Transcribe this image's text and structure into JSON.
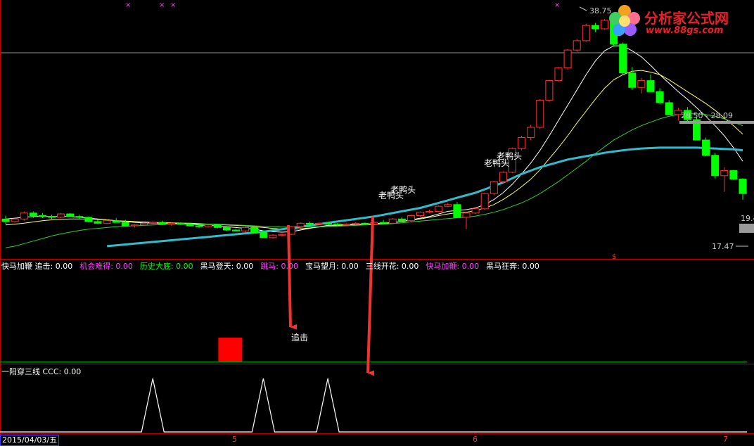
{
  "colors": {
    "up": "#ff3232",
    "down": "#00ff00",
    "ma_white": "#ffffff",
    "ma_yellow": "#ffff66",
    "ma_green": "#33cc33",
    "ma_cyan": "#33bbcc",
    "magenta": "#ff44ff",
    "signal_red": "#ff0000",
    "arrow": "#ee3333"
  },
  "logo": {
    "title": "分析家公式网",
    "url": "www.88gs.com"
  },
  "price_labels": {
    "high": "38.75",
    "range": "28.50 - 28.09",
    "low": "17.47",
    "right_cut": "19.4"
  },
  "annotations": {
    "pattern_a": "老鸭头",
    "pattern_b": "老鸭头",
    "signal_label": "追击"
  },
  "indicator_panel": {
    "items": [
      {
        "label": "快马加鞭 追击: 0.00",
        "color": "#ffffff"
      },
      {
        "label": "机会难得: 0.00",
        "color": "#ff44ff"
      },
      {
        "label": "历史大底: 0.00",
        "color": "#00ff00"
      },
      {
        "label": "黑马登天: 0.00",
        "color": "#ffffff"
      },
      {
        "label": "跳马: 0.00",
        "color": "#ff44ff"
      },
      {
        "label": "宝马望月: 0.00",
        "color": "#ffffff"
      },
      {
        "label": "三线开花: 0.00",
        "color": "#ffffff"
      },
      {
        "label": "快马加鞭: 0.00",
        "color": "#ff44ff"
      },
      {
        "label": "黑马狂奔: 0.00",
        "color": "#ffffff"
      }
    ]
  },
  "lower_panel": {
    "label": "一阳穿三线 CCC: 0.00"
  },
  "x_axis": {
    "date": "2015/04/03/五",
    "ticks": [
      "5",
      "6",
      "7"
    ]
  },
  "chart_data": {
    "type": "candlestick",
    "candles": [
      [
        15.2,
        15.6,
        14.6,
        14.9
      ],
      [
        14.9,
        15.3,
        14.8,
        15.2
      ],
      [
        15.2,
        16.1,
        15.0,
        15.9
      ],
      [
        15.9,
        16.1,
        15.3,
        15.6
      ],
      [
        15.6,
        15.9,
        15.3,
        15.5
      ],
      [
        15.5,
        15.7,
        15.2,
        15.4
      ],
      [
        15.4,
        15.9,
        15.3,
        15.8
      ],
      [
        15.8,
        15.9,
        15.4,
        15.5
      ],
      [
        15.5,
        15.7,
        15.2,
        15.4
      ],
      [
        15.4,
        15.5,
        14.8,
        14.9
      ],
      [
        14.9,
        15.1,
        14.6,
        14.7
      ],
      [
        14.7,
        15.1,
        14.6,
        15.0
      ],
      [
        15.0,
        15.3,
        14.8,
        14.8
      ],
      [
        14.8,
        15.1,
        14.3,
        14.4
      ],
      [
        14.4,
        14.6,
        14.2,
        14.5
      ],
      [
        14.5,
        14.8,
        14.4,
        14.7
      ],
      [
        14.7,
        14.9,
        14.6,
        14.8
      ],
      [
        14.8,
        15.0,
        14.5,
        14.6
      ],
      [
        14.6,
        14.8,
        14.4,
        14.7
      ],
      [
        14.7,
        14.8,
        14.5,
        14.6
      ],
      [
        14.6,
        14.7,
        14.3,
        14.4
      ],
      [
        14.4,
        14.6,
        14.2,
        14.3
      ],
      [
        14.3,
        14.6,
        14.2,
        14.5
      ],
      [
        14.5,
        14.6,
        14.1,
        14.2
      ],
      [
        14.2,
        14.4,
        13.8,
        13.9
      ],
      [
        13.9,
        14.1,
        13.7,
        13.8
      ],
      [
        13.8,
        14.3,
        13.6,
        14.2
      ],
      [
        14.2,
        14.4,
        13.8,
        13.6
      ],
      [
        13.6,
        13.8,
        13.0,
        13.0
      ],
      [
        13.0,
        13.4,
        12.9,
        13.3
      ],
      [
        13.3,
        13.5,
        13.1,
        13.4
      ],
      [
        13.4,
        14.4,
        13.3,
        14.3
      ],
      [
        14.3,
        14.8,
        14.1,
        14.7
      ],
      [
        14.7,
        14.9,
        14.5,
        14.6
      ],
      [
        14.6,
        14.8,
        14.5,
        14.7
      ],
      [
        14.7,
        14.8,
        14.5,
        14.6
      ],
      [
        14.6,
        14.7,
        14.4,
        14.5
      ],
      [
        14.5,
        14.7,
        14.4,
        14.6
      ],
      [
        14.6,
        14.8,
        14.5,
        14.7
      ],
      [
        14.7,
        14.8,
        14.5,
        14.6
      ],
      [
        14.6,
        14.9,
        14.5,
        14.8
      ],
      [
        14.8,
        15.1,
        14.6,
        14.7
      ],
      [
        14.7,
        15.3,
        14.6,
        15.2
      ],
      [
        15.2,
        15.4,
        14.9,
        15.0
      ],
      [
        15.0,
        15.7,
        14.9,
        15.6
      ],
      [
        15.6,
        16.1,
        15.5,
        16.0
      ],
      [
        16.0,
        16.3,
        15.9,
        16.1
      ],
      [
        16.1,
        16.8,
        16.0,
        16.7
      ],
      [
        16.7,
        17.1,
        16.6,
        16.9
      ],
      [
        16.9,
        17.2,
        15.3,
        15.4
      ],
      [
        15.4,
        16.0,
        14.0,
        15.9
      ],
      [
        15.9,
        16.6,
        15.8,
        16.4
      ],
      [
        16.4,
        18.3,
        16.3,
        18.2
      ],
      [
        18.2,
        19.7,
        18.0,
        19.6
      ],
      [
        19.6,
        20.8,
        19.4,
        20.7
      ],
      [
        20.7,
        23.6,
        20.6,
        23.5
      ],
      [
        23.5,
        25.0,
        23.3,
        24.8
      ],
      [
        24.8,
        26.3,
        24.5,
        26.0
      ],
      [
        26.0,
        29.3,
        25.8,
        29.2
      ],
      [
        29.2,
        31.6,
        29.0,
        31.5
      ],
      [
        31.5,
        33.1,
        31.4,
        33.0
      ],
      [
        33.0,
        35.2,
        32.8,
        35.1
      ],
      [
        35.1,
        36.4,
        34.9,
        36.2
      ],
      [
        36.2,
        38.2,
        36.1,
        38.0
      ],
      [
        38.0,
        38.3,
        37.2,
        37.6
      ],
      [
        37.6,
        38.75,
        37.5,
        38.6
      ],
      [
        38.6,
        38.7,
        35.5,
        35.8
      ],
      [
        35.8,
        36.0,
        32.2,
        32.4
      ],
      [
        32.4,
        33.1,
        30.4,
        30.7
      ],
      [
        30.7,
        31.8,
        30.0,
        31.5
      ],
      [
        31.5,
        32.2,
        30.8,
        30.2
      ],
      [
        30.2,
        30.6,
        28.7,
        28.9
      ],
      [
        28.9,
        29.2,
        27.8,
        27.5
      ],
      [
        27.5,
        28.3,
        26.8,
        28.0
      ],
      [
        28.0,
        28.4,
        26.7,
        26.9
      ],
      [
        26.9,
        27.2,
        26.0,
        24.5
      ],
      [
        24.5,
        24.8,
        22.6,
        22.7
      ],
      [
        22.7,
        23.0,
        20.0,
        20.3
      ],
      [
        20.3,
        21.3,
        18.4,
        20.9
      ],
      [
        20.9,
        21.0,
        19.8,
        19.9
      ],
      [
        19.9,
        20.0,
        17.47,
        18.2
      ]
    ],
    "ma_white": [
      15.2,
      15.3,
      15.4,
      15.5,
      15.5,
      15.5,
      15.5,
      15.5,
      15.4,
      15.3,
      15.2,
      15.1,
      15.0,
      14.9,
      14.8,
      14.75,
      14.7,
      14.7,
      14.7,
      14.65,
      14.6,
      14.5,
      14.45,
      14.4,
      14.3,
      14.2,
      14.1,
      14.0,
      13.8,
      13.7,
      13.65,
      13.7,
      13.9,
      14.1,
      14.3,
      14.45,
      14.5,
      14.55,
      14.6,
      14.6,
      14.6,
      14.65,
      14.75,
      14.9,
      15.1,
      15.3,
      15.5,
      15.8,
      16.1,
      16.2,
      16.3,
      16.5,
      16.9,
      17.5,
      18.3,
      19.3,
      20.5,
      21.8,
      23.3,
      25.0,
      26.8,
      28.6,
      30.4,
      32.2,
      33.8,
      35.0,
      35.6,
      35.6,
      35.0,
      34.3,
      33.3,
      32.2,
      31.2,
      30.2,
      29.3,
      28.3,
      27.3,
      26.2,
      25.0,
      23.6,
      22.0
    ],
    "ma_yellow": [
      14.5,
      14.6,
      14.7,
      14.85,
      15.0,
      15.1,
      15.15,
      15.2,
      15.2,
      15.2,
      15.15,
      15.1,
      15.0,
      14.95,
      14.9,
      14.85,
      14.8,
      14.78,
      14.75,
      14.72,
      14.7,
      14.65,
      14.6,
      14.55,
      14.5,
      14.45,
      14.4,
      14.3,
      14.2,
      14.1,
      14.0,
      14.0,
      14.05,
      14.15,
      14.25,
      14.35,
      14.42,
      14.5,
      14.55,
      14.6,
      14.65,
      14.7,
      14.8,
      14.9,
      15.05,
      15.2,
      15.4,
      15.6,
      15.8,
      15.95,
      16.0,
      16.2,
      16.5,
      16.9,
      17.5,
      18.2,
      19.0,
      19.9,
      21.0,
      22.3,
      23.6,
      25.0,
      26.5,
      27.9,
      29.3,
      30.6,
      31.6,
      32.2,
      32.6,
      32.7,
      32.5,
      32.2,
      31.6,
      30.9,
      30.2,
      29.5,
      28.8,
      28.0,
      27.1,
      26.2,
      25.2
    ],
    "ma_green": [
      11.8,
      12.0,
      12.3,
      12.6,
      12.9,
      13.2,
      13.45,
      13.65,
      13.85,
      14.0,
      14.1,
      14.2,
      14.3,
      14.35,
      14.4,
      14.45,
      14.5,
      14.55,
      14.6,
      14.6,
      14.6,
      14.6,
      14.6,
      14.6,
      14.55,
      14.5,
      14.45,
      14.4,
      14.35,
      14.3,
      14.25,
      14.25,
      14.25,
      14.27,
      14.3,
      14.32,
      14.35,
      14.4,
      14.45,
      14.5,
      14.55,
      14.6,
      14.65,
      14.75,
      14.85,
      14.95,
      15.05,
      15.15,
      15.25,
      15.35,
      15.4,
      15.55,
      15.75,
      16.0,
      16.3,
      16.7,
      17.1,
      17.6,
      18.2,
      18.9,
      19.6,
      20.4,
      21.2,
      22.0,
      22.9,
      23.7,
      24.5,
      25.1,
      25.7,
      26.2,
      26.6,
      27.0,
      27.3,
      27.5,
      27.6,
      27.6,
      27.5,
      27.3,
      27.0,
      26.6,
      26.2
    ],
    "ma_cyan": [
      null,
      null,
      null,
      null,
      null,
      null,
      null,
      null,
      null,
      null,
      null,
      12.0,
      12.1,
      12.2,
      12.3,
      12.4,
      12.5,
      12.6,
      12.7,
      12.8,
      12.9,
      13.0,
      13.1,
      13.2,
      13.3,
      13.4,
      13.5,
      13.6,
      13.7,
      13.85,
      14.0,
      14.15,
      14.3,
      14.45,
      14.6,
      14.75,
      14.9,
      15.05,
      15.2,
      15.35,
      15.5,
      15.7,
      15.9,
      16.1,
      16.3,
      16.5,
      16.8,
      17.1,
      17.4,
      17.7,
      18.0,
      18.3,
      18.7,
      19.1,
      19.5,
      20.0,
      20.5,
      20.9,
      21.3,
      21.6,
      21.9,
      22.2,
      22.4,
      22.6,
      22.8,
      23.0,
      23.15,
      23.3,
      23.4,
      23.5,
      23.55,
      23.6,
      23.6,
      23.6,
      23.6,
      23.6,
      23.55,
      23.5,
      23.45,
      23.4,
      23.3
    ],
    "signal_bars": [
      {
        "index": 24,
        "value": 1
      }
    ],
    "ccc_peaks": [
      12,
      24,
      31
    ],
    "ylim": [
      11.0,
      40.0
    ],
    "ccc_ylim": [
      0,
      1
    ]
  }
}
